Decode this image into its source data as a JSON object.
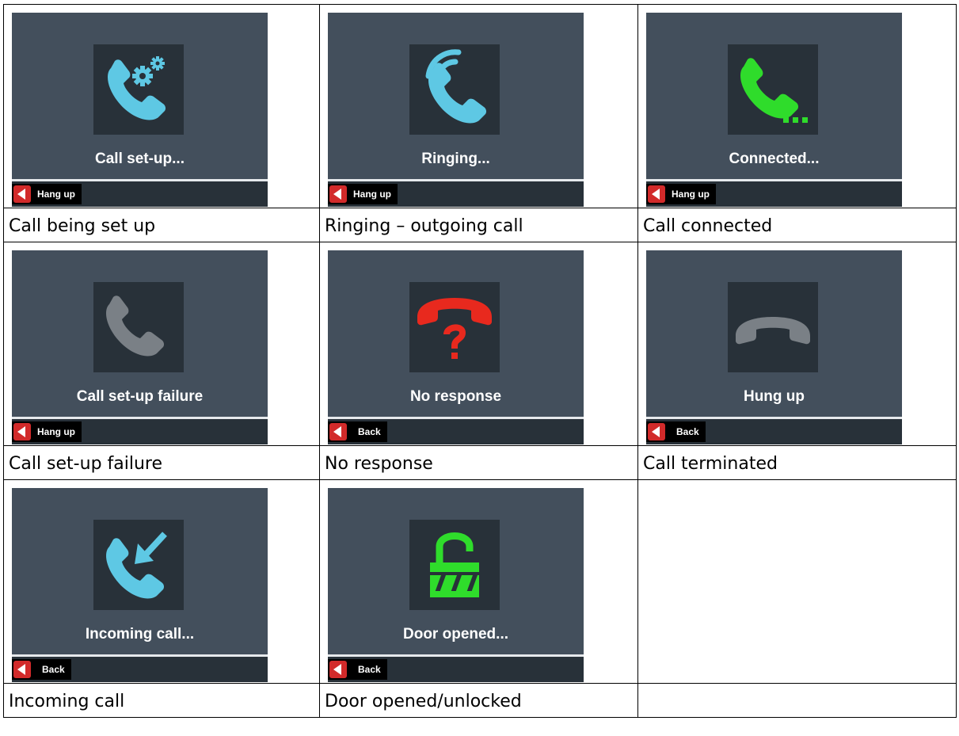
{
  "colors": {
    "screen_bg": "#434f5c",
    "icon_bg": "#283139",
    "blue": "#5ec8e4",
    "green": "#2fdc2b",
    "red": "#e8291e",
    "gray": "#7a8086",
    "softkey_red": "#d22a2a"
  },
  "cells": [
    {
      "screen_title": "Call set-up...",
      "softkey": "Hang up",
      "icon": "phone-gear-icon",
      "caption": "Call being set up"
    },
    {
      "screen_title": "Ringing...",
      "softkey": "Hang up",
      "icon": "phone-ringing-icon",
      "caption": "Ringing – outgoing call"
    },
    {
      "screen_title": "Connected...",
      "softkey": "Hang up",
      "icon": "phone-connected-icon",
      "caption": "Call connected"
    },
    {
      "screen_title": "Call set-up failure",
      "softkey": "Hang up",
      "icon": "phone-failure-icon",
      "caption": "Call set-up failure"
    },
    {
      "screen_title": "No response",
      "softkey": "Back",
      "icon": "phone-no-response-icon",
      "caption": "No response"
    },
    {
      "screen_title": "Hung up",
      "softkey": "Back",
      "icon": "phone-hung-up-icon",
      "caption": "Call terminated"
    },
    {
      "screen_title": "Incoming call...",
      "softkey": "Back",
      "icon": "phone-incoming-icon",
      "caption": "Incoming call"
    },
    {
      "screen_title": "Door opened...",
      "softkey": "Back",
      "icon": "padlock-open-icon",
      "caption": "Door opened/unlocked"
    }
  ]
}
